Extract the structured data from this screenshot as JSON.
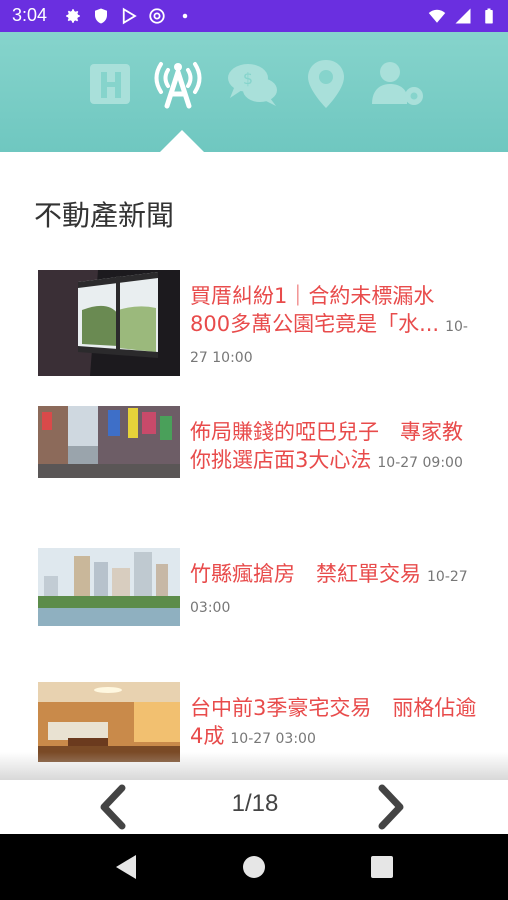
{
  "status_bar": {
    "time": "3:04",
    "left_icons": [
      "gear-icon",
      "shield-icon",
      "play-store-icon",
      "circle-at-icon",
      "dot-icon"
    ],
    "right_icons": [
      "wifi-icon",
      "signal-icon",
      "battery-icon"
    ],
    "background": "#6a2fe0"
  },
  "header": {
    "background": "#78cbc4",
    "tabs": [
      {
        "name": "hospital-icon",
        "active": false
      },
      {
        "name": "antenna-icon",
        "active": true
      },
      {
        "name": "chat-icon",
        "active": false
      },
      {
        "name": "location-icon",
        "active": false
      },
      {
        "name": "user-settings-icon",
        "active": false
      }
    ]
  },
  "section": {
    "title": "不動產新聞"
  },
  "news": [
    {
      "title": "買厝糾紛1｜合約未標漏水　800多萬公園宅竟是「水...",
      "time": "10-27 10:00"
    },
    {
      "title": "佈局賺錢的啞巴兒子　專家教你挑選店面3大心法",
      "time": "10-27 09:00"
    },
    {
      "title": "竹縣瘋搶房　禁紅單交易",
      "time": "10-27 03:00"
    },
    {
      "title": "台中前3季豪宅交易　丽格佔逾4成",
      "time": "10-27 03:00"
    }
  ],
  "pager": {
    "label": "1/18"
  },
  "accent_color": "#e84b4b"
}
